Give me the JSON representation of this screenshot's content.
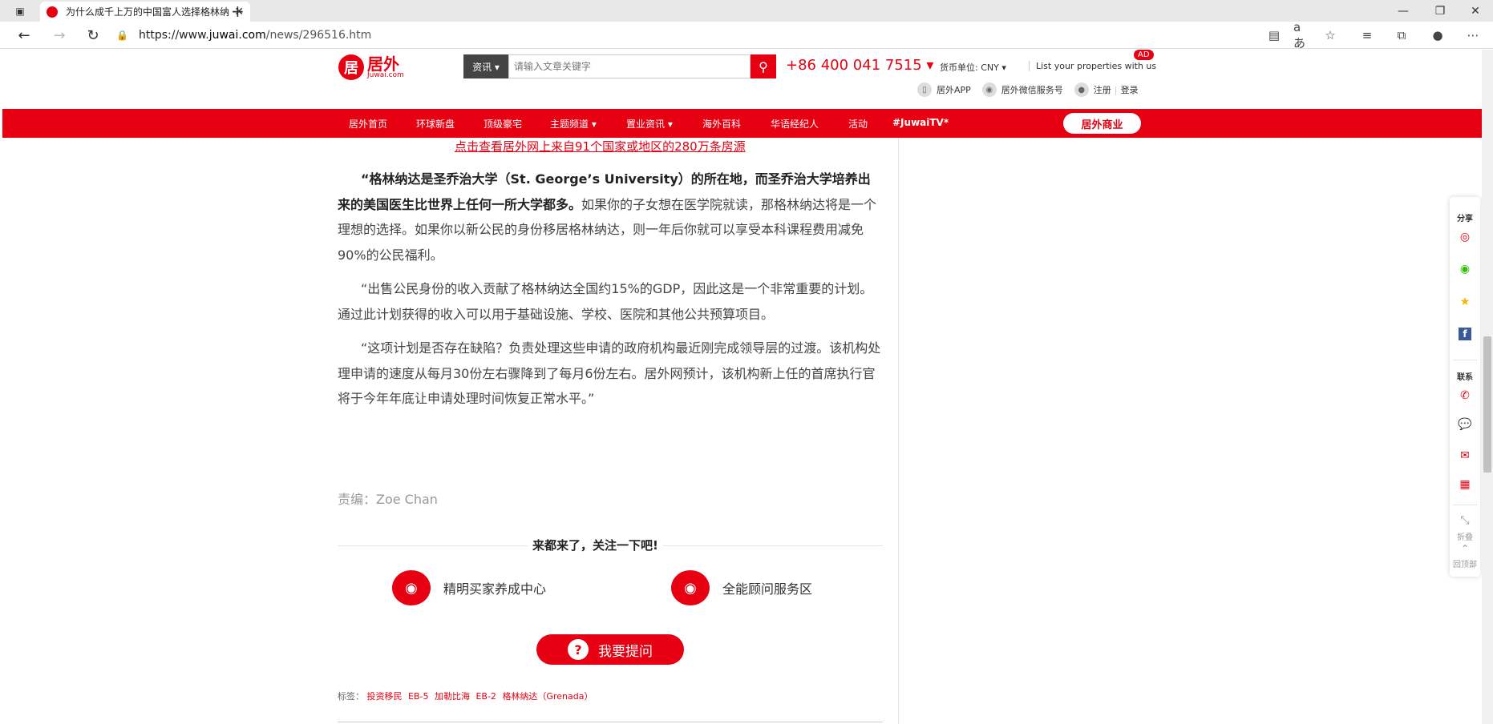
{
  "browser": {
    "tab_title": "为什么成千上万的中国富人选择格林纳达",
    "url_prefix": "https://www.",
    "url_domain": "juwai.com",
    "url_path": "/news/296516.htm"
  },
  "header": {
    "logo_cn": "居外",
    "logo_en": "Juwai.com",
    "search_category": "资讯 ▾",
    "search_placeholder": "请输入文章关键字",
    "phone": "+86 400 041 7515 ▾",
    "currency": "货币单位: CNY ▾",
    "list_properties": "List your properties with us",
    "ad_badge": "AD",
    "app": "居外APP",
    "wechat_service": "居外微信服务号",
    "register": "注册",
    "login": "登录"
  },
  "nav": {
    "items": [
      "居外首页",
      "环球新盘",
      "顶级豪宅",
      "主题频道 ▾",
      "置业资讯 ▾",
      "海外百科",
      "华语经纪人",
      "活动",
      "#JuwaiTV*"
    ],
    "business": "居外商业"
  },
  "article": {
    "source_link": "点击查看居外网上来自91个国家或地区的280万条房源",
    "p1_bold": "“格林纳达是圣乔治大学（St. George’s University）的所在地，而圣乔治大学培养出来的美国医生比世界上任何一所大学都多。",
    "p1_rest": "如果你的子女想在医学院就读，那格林纳达将是一个理想的选择。如果你以新公民的身份移居格林纳达，则一年后你就可以享受本科课程费用减免90%的公民福利。",
    "p2": "“出售公民身份的收入贡献了格林纳达全国约15%的GDP，因此这是一个非常重要的计划。通过此计划获得的收入可以用于基础设施、学校、医院和其他公共预算项目。",
    "p3": "“这项计划是否存在缺陷？负责处理这些申请的政府机构最近刚完成领导层的过渡。该机构处理申请的速度从每月30份左右骤降到了每月6份左右。居外网预计，该机构新上任的首席执行官将于今年年底让申请处理时间恢复正常水平。”",
    "editor": "责编：Zoe Chan",
    "follow_title": "来都来了，关注一下吧!",
    "follow_1": "精明买家养成中心",
    "follow_2": "全能顾问服务区",
    "ask": "我要提问",
    "tags_label": "标签：",
    "tags": [
      "投资移民",
      "EB-5",
      "加勒比海",
      "EB-2",
      "格林纳达（Grenada）"
    ]
  },
  "sidebar": {
    "share": "分享",
    "contact": "联系",
    "collapse": "折叠",
    "back_top": "回顶部"
  }
}
